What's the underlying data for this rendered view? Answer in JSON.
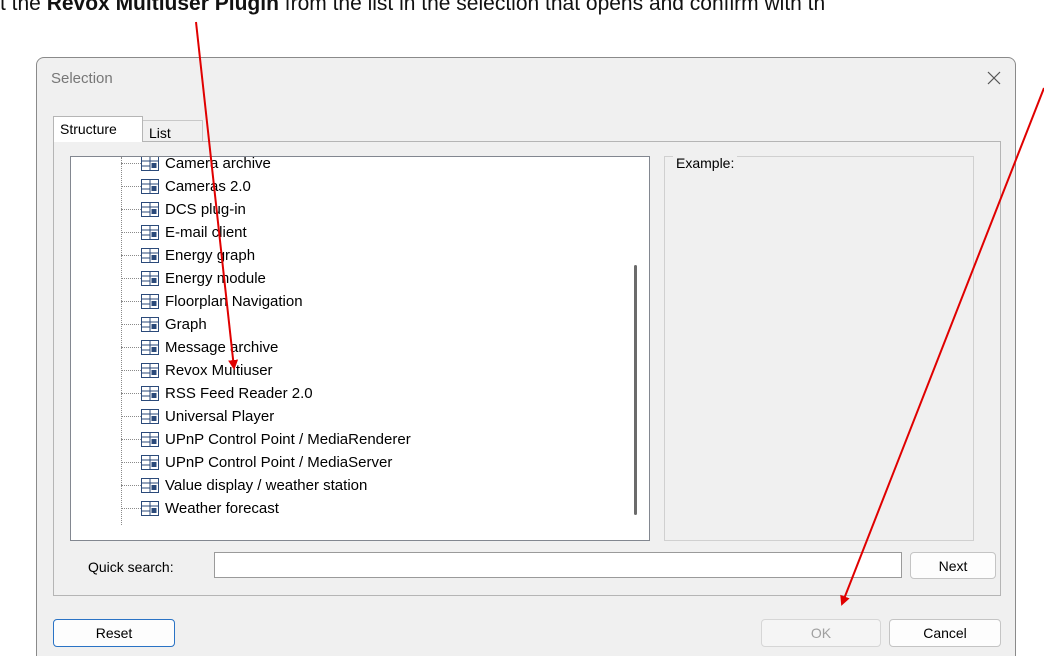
{
  "instruction": {
    "prefix": "t the ",
    "bold": "Revox Multiuser Plugin",
    "suffix": " from the list in the selection that opens and confirm with th"
  },
  "dialog": {
    "title": "Selection",
    "tabs": [
      {
        "label": "Structure",
        "active": true
      },
      {
        "label": "List",
        "active": false
      }
    ],
    "tree_items": [
      "Camera archive",
      "Cameras 2.0",
      "DCS plug-in",
      "E-mail client",
      "Energy graph",
      "Energy module",
      "Floorplan Navigation",
      "Graph",
      "Message archive",
      "Revox Multiuser",
      "RSS Feed Reader 2.0",
      "Universal Player",
      "UPnP Control Point / MediaRenderer",
      "UPnP Control Point / MediaServer",
      "Value display / weather station",
      "Weather forecast"
    ],
    "example_label": "Example:",
    "quick_search_label": "Quick search:",
    "quick_search_value": "",
    "buttons": {
      "next": "Next",
      "reset": "Reset",
      "ok": "OK",
      "cancel": "Cancel"
    }
  },
  "colors": {
    "annotation_arrow": "#e00000",
    "reset_border": "#2a73c5",
    "dialog_background": "#f0f0f0"
  },
  "icons": [
    "close-icon",
    "tree-node-icon"
  ]
}
